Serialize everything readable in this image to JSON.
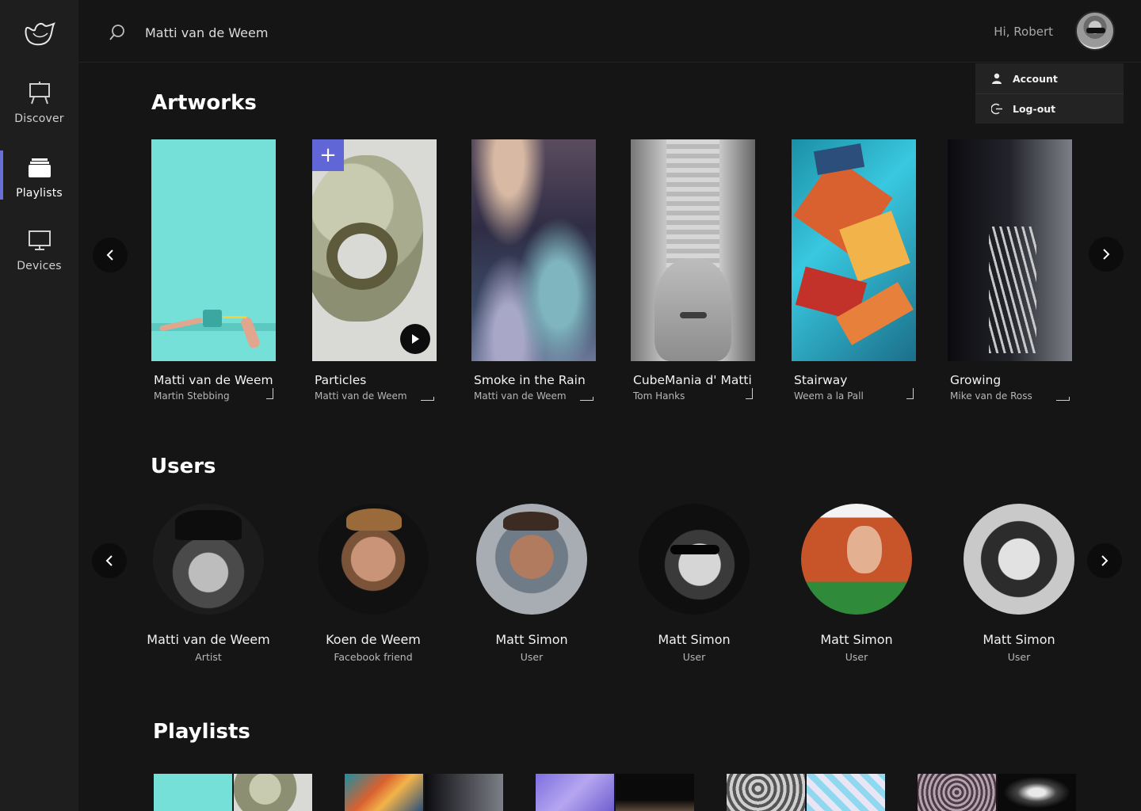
{
  "sidebar": {
    "items": [
      {
        "label": "Discover",
        "icon": "easel-icon"
      },
      {
        "label": "Playlists",
        "icon": "folder-stack-icon"
      },
      {
        "label": "Devices",
        "icon": "monitor-icon"
      }
    ],
    "accent": "#6a6fd8"
  },
  "topbar": {
    "search_value": "Matti van de Weem",
    "greeting": "Hi, Robert"
  },
  "dropdown": {
    "items": [
      {
        "label": "Account",
        "icon": "user-icon"
      },
      {
        "label": "Log-out",
        "icon": "logout-icon"
      }
    ]
  },
  "sections": {
    "artworks": "Artworks",
    "users": "Users",
    "playlists": "Playlists"
  },
  "artworks": [
    {
      "title": "Matti van de Weem",
      "author": "Martin Stebbing"
    },
    {
      "title": "Particles",
      "author": "Matti van de Weem"
    },
    {
      "title": "Smoke in the Rain",
      "author": "Matti van de Weem"
    },
    {
      "title": "CubeMania d' Matti",
      "author": "Tom Hanks"
    },
    {
      "title": "Stairway",
      "author": "Weem  a la Pall"
    },
    {
      "title": "Growing",
      "author": "Mike van de Ross"
    }
  ],
  "users": [
    {
      "name": "Matti van de Weem",
      "role": "Artist"
    },
    {
      "name": "Koen de Weem",
      "role": "Facebook friend"
    },
    {
      "name": "Matt Simon",
      "role": "User"
    },
    {
      "name": "Matt Simon",
      "role": "User"
    },
    {
      "name": "Matt Simon",
      "role": "User"
    },
    {
      "name": "Matt Simon",
      "role": "User"
    }
  ],
  "colors": {
    "background": "#151515",
    "sidebar": "#1e1e1e",
    "accent": "#6166d6"
  }
}
